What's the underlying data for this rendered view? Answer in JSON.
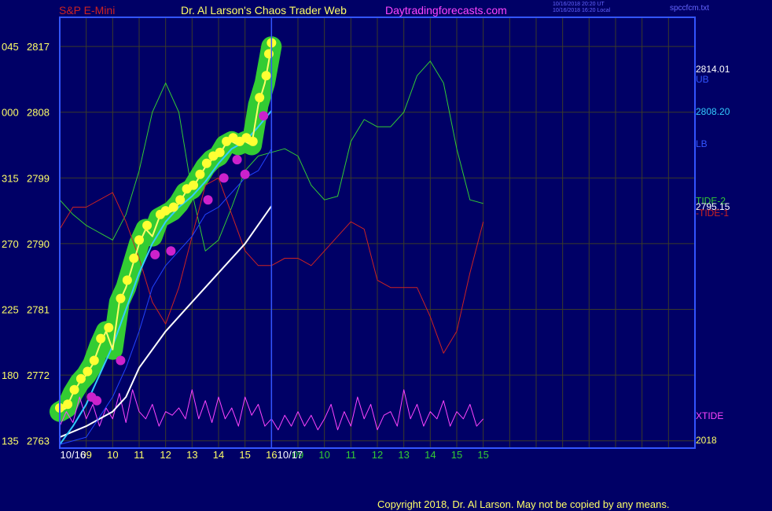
{
  "header": {
    "symbol": "S&P E-Mini",
    "site_title": "Dr. Al Larson's Chaos Trader Web",
    "site_url": "Daytradingforecasts.com",
    "stamp_line1": "10/16/2018 20:20 UT",
    "stamp_line2": "10/16/2018 16:20 Local",
    "file": "spccfcm.txt"
  },
  "footer": {
    "copyright": "Copyright 2018, Dr. Al Larson. May not be copied by any means."
  },
  "colors": {
    "background": "#000066",
    "grid": "#3a3a2a",
    "price": "#ffff66",
    "tide2": "#33cc33",
    "tide1": "#cc2222",
    "xtide": "#ff44ff",
    "cyan_avg": "#33ccff",
    "blue_avg": "#2244ff",
    "white_avg": "#ffffff",
    "highlight": "#33cc33",
    "markers_up": "#ffff33",
    "markers_down": "#cc22cc"
  },
  "chart_data": {
    "type": "line",
    "title": "S&P E-Mini",
    "y_axis": {
      "labels": [
        {
          "left": "045",
          "right": "2817",
          "value": 2817
        },
        {
          "left": "000",
          "right": "2808",
          "value": 2808
        },
        {
          "left": "315",
          "right": "2799",
          "value": 2799
        },
        {
          "left": "270",
          "right": "2790",
          "value": 2790
        },
        {
          "left": "225",
          "right": "2781",
          "value": 2781
        },
        {
          "left": "180",
          "right": "2772",
          "value": 2772
        },
        {
          "left": "135",
          "right": "2763",
          "value": 2763
        }
      ],
      "range": [
        2762,
        2821
      ]
    },
    "x_axis": {
      "range": [
        8.0,
        32.0
      ],
      "hour_labels": [
        {
          "x": 9,
          "label": "09",
          "color": "#ffff66"
        },
        {
          "x": 10,
          "label": "10",
          "color": "#ffff66"
        },
        {
          "x": 11,
          "label": "11",
          "color": "#ffff66"
        },
        {
          "x": 12,
          "label": "12",
          "color": "#ffff66"
        },
        {
          "x": 13,
          "label": "13",
          "color": "#ffff66"
        },
        {
          "x": 14,
          "label": "14",
          "color": "#ffff66"
        },
        {
          "x": 15,
          "label": "15",
          "color": "#ffff66"
        },
        {
          "x": 16,
          "label": "16",
          "color": "#ffff66"
        },
        {
          "x": 17,
          "label": "09",
          "color": "#33cc33"
        },
        {
          "x": 18,
          "label": "10",
          "color": "#33cc33"
        },
        {
          "x": 19,
          "label": "11",
          "color": "#33cc33"
        },
        {
          "x": 20,
          "label": "12",
          "color": "#33cc33"
        },
        {
          "x": 21,
          "label": "13",
          "color": "#33cc33"
        },
        {
          "x": 22,
          "label": "14",
          "color": "#33cc33"
        },
        {
          "x": 23,
          "label": "15",
          "color": "#33cc33"
        },
        {
          "x": 24,
          "label": "15",
          "color": "#33cc33"
        }
      ],
      "date_labels": [
        {
          "x": 8.5,
          "label": "10/16"
        },
        {
          "x": 16.7,
          "label": "10/17"
        }
      ],
      "now_x": 16.0
    },
    "right_labels": [
      {
        "y": 2814.01,
        "text": "2814.01",
        "color": "#ffffff"
      },
      {
        "y": 2812.6,
        "text": "UB",
        "color": "#3355ff"
      },
      {
        "y": 2808.2,
        "text": "2808.20",
        "color": "#33ccff"
      },
      {
        "y": 2803.8,
        "text": "LB",
        "color": "#3355ff"
      },
      {
        "y": 2795.95,
        "text": "TIDE-2",
        "color": "#33cc33"
      },
      {
        "y": 2795.15,
        "text": "2795.15",
        "color": "#ffffff"
      },
      {
        "y": 2794.3,
        "text": "-TIDE-1",
        "color": "#cc2222"
      },
      {
        "y": 2766.5,
        "text": "XTIDE",
        "color": "#ff44ff"
      },
      {
        "y": 2763.2,
        "text": "2018",
        "color": "#ffff66"
      }
    ],
    "series": [
      {
        "name": "TIDE-2",
        "color": "#33cc33",
        "x": [
          8.0,
          8.5,
          9.0,
          9.5,
          10.0,
          10.5,
          11.0,
          11.5,
          12.0,
          12.5,
          13.0,
          13.5,
          14.0,
          14.5,
          15.0,
          15.5,
          16.0,
          16.5,
          17.0,
          17.5,
          18.0,
          18.5,
          19.0,
          19.5,
          20.0,
          20.5,
          21.0,
          21.5,
          22.0,
          22.5,
          23.0,
          23.5,
          24.0
        ],
        "y": [
          2796,
          2794,
          2792.5,
          2791.5,
          2790.5,
          2794,
          2800,
          2808,
          2812,
          2808,
          2797,
          2789,
          2790.5,
          2795,
          2800,
          2802,
          2802.5,
          2803,
          2802,
          2798,
          2796,
          2796.5,
          2804,
          2807,
          2806,
          2806,
          2808,
          2813,
          2815,
          2812,
          2803,
          2796,
          2795.5
        ]
      },
      {
        "name": "-TIDE-1",
        "color": "#cc2222",
        "x": [
          8.0,
          8.5,
          9.0,
          9.5,
          10.0,
          10.5,
          11.0,
          11.5,
          12.0,
          12.5,
          13.0,
          13.5,
          14.0,
          14.5,
          15.0,
          15.5,
          16.0,
          16.5,
          17.0,
          17.5,
          18.0,
          18.5,
          19.0,
          19.5,
          20.0,
          20.5,
          21.0,
          21.5,
          22.0,
          22.5,
          23.0,
          23.5,
          24.0
        ],
        "y": [
          2792,
          2795,
          2795,
          2796,
          2797,
          2793,
          2788,
          2782,
          2779,
          2784,
          2791,
          2798,
          2799,
          2794,
          2789,
          2787,
          2787,
          2788,
          2788,
          2787,
          2789,
          2791,
          2793,
          2792,
          2785,
          2784,
          2784,
          2784,
          2780,
          2775,
          2778,
          2786,
          2793
        ]
      },
      {
        "name": "XTIDE",
        "color": "#ff44ff",
        "x": [
          8.0,
          8.25,
          8.5,
          8.75,
          9.0,
          9.25,
          9.5,
          9.75,
          10.0,
          10.25,
          10.5,
          10.75,
          11.0,
          11.25,
          11.5,
          11.75,
          12.0,
          12.25,
          12.5,
          12.75,
          13.0,
          13.25,
          13.5,
          13.75,
          14.0,
          14.25,
          14.5,
          14.75,
          15.0,
          15.25,
          15.5,
          15.75,
          16.0,
          16.25,
          16.5,
          16.75,
          17.0,
          17.25,
          17.5,
          17.75,
          18.0,
          18.25,
          18.5,
          18.75,
          19.0,
          19.25,
          19.5,
          19.75,
          20.0,
          20.25,
          20.5,
          20.75,
          21.0,
          21.25,
          21.5,
          21.75,
          22.0,
          22.25,
          22.5,
          22.75,
          23.0,
          23.25,
          23.5,
          23.75,
          24.0
        ],
        "y": [
          2765,
          2767,
          2765.5,
          2769,
          2766,
          2768,
          2765,
          2767.5,
          2766,
          2769.5,
          2765.5,
          2770,
          2767,
          2766,
          2768,
          2765,
          2767,
          2766.5,
          2767.5,
          2766,
          2770,
          2766,
          2768.5,
          2765.5,
          2769,
          2766,
          2767.5,
          2765,
          2769,
          2766.5,
          2768,
          2765,
          2766,
          2764.5,
          2766.5,
          2765,
          2767,
          2765,
          2766.5,
          2764.5,
          2766,
          2768,
          2764.5,
          2767,
          2765,
          2769,
          2766,
          2768,
          2764.5,
          2766.5,
          2767,
          2765,
          2770,
          2766,
          2768,
          2765,
          2767,
          2766,
          2768.5,
          2765,
          2767,
          2766,
          2768,
          2765,
          2766
        ]
      },
      {
        "name": "White average",
        "color": "#ffffff",
        "x": [
          8.0,
          9.0,
          10.0,
          10.5,
          11.0,
          12.0,
          13.0,
          14.0,
          15.0,
          16.0
        ],
        "y": [
          2763.5,
          2765,
          2767,
          2769,
          2773,
          2778,
          2782,
          2786,
          2790,
          2795.15
        ]
      },
      {
        "name": "Blue average",
        "color": "#2244ff",
        "x": [
          8.0,
          9.0,
          10.0,
          10.5,
          11.0,
          11.5,
          12.0,
          12.5,
          13.0,
          13.5,
          14.0,
          14.5,
          15.0,
          15.5,
          16.0
        ],
        "y": [
          2762.5,
          2763.5,
          2769,
          2773,
          2778,
          2784,
          2787,
          2789,
          2791,
          2794,
          2795,
          2797,
          2799,
          2800,
          2803
        ]
      },
      {
        "name": "Cyan average",
        "color": "#33ccff",
        "x": [
          8.0,
          8.5,
          9.0,
          9.5,
          10.0,
          10.5,
          11.0,
          11.5,
          12.0,
          12.5,
          13.0,
          13.5,
          14.0,
          14.5,
          15.0,
          15.5,
          16.0
        ],
        "y": [
          2762.5,
          2765,
          2768,
          2772,
          2776,
          2781,
          2786,
          2790,
          2793,
          2795,
          2796.5,
          2798.5,
          2801,
          2803,
          2804,
          2806,
          2808.2
        ]
      },
      {
        "name": "Price",
        "color": "#ffff66",
        "x": [
          8.0,
          8.25,
          8.5,
          8.75,
          9.0,
          9.25,
          9.5,
          9.75,
          10.0,
          10.25,
          10.5,
          10.75,
          11.0,
          11.25,
          11.5,
          11.75,
          12.0,
          12.25,
          12.5,
          12.75,
          13.0,
          13.25,
          13.5,
          13.75,
          14.0,
          14.25,
          14.5,
          14.75,
          15.0,
          15.25,
          15.5,
          15.75,
          16.0
        ],
        "y": [
          2767,
          2767.5,
          2769.5,
          2771,
          2772,
          2773.5,
          2776,
          2778,
          2775.5,
          2782,
          2784,
          2787,
          2790,
          2792,
          2791,
          2793.5,
          2794,
          2794.5,
          2795.5,
          2797,
          2797.5,
          2799,
          2800.5,
          2801.5,
          2802,
          2803.5,
          2804,
          2803.5,
          2804,
          2803.5,
          2809,
          2812,
          2817
        ]
      }
    ],
    "highlight_band": {
      "color": "#33cc33",
      "along": "Price"
    },
    "markers": {
      "up": [
        {
          "x": 8.0,
          "y": 2767.5
        },
        {
          "x": 8.3,
          "y": 2768
        },
        {
          "x": 8.55,
          "y": 2770
        },
        {
          "x": 8.8,
          "y": 2771.5
        },
        {
          "x": 9.05,
          "y": 2772.5
        },
        {
          "x": 9.3,
          "y": 2774
        },
        {
          "x": 9.55,
          "y": 2777
        },
        {
          "x": 9.85,
          "y": 2778.5
        },
        {
          "x": 10.3,
          "y": 2782.5
        },
        {
          "x": 10.55,
          "y": 2785
        },
        {
          "x": 10.8,
          "y": 2788
        },
        {
          "x": 11.0,
          "y": 2790.5
        },
        {
          "x": 11.3,
          "y": 2792.5
        },
        {
          "x": 11.8,
          "y": 2794
        },
        {
          "x": 12.0,
          "y": 2794.5
        },
        {
          "x": 12.3,
          "y": 2795
        },
        {
          "x": 12.55,
          "y": 2796
        },
        {
          "x": 12.8,
          "y": 2797.5
        },
        {
          "x": 13.05,
          "y": 2798
        },
        {
          "x": 13.3,
          "y": 2799.5
        },
        {
          "x": 13.55,
          "y": 2801
        },
        {
          "x": 13.8,
          "y": 2802
        },
        {
          "x": 14.05,
          "y": 2802.5
        },
        {
          "x": 14.3,
          "y": 2804
        },
        {
          "x": 14.55,
          "y": 2804.5
        },
        {
          "x": 14.8,
          "y": 2804
        },
        {
          "x": 15.05,
          "y": 2804.5
        },
        {
          "x": 15.3,
          "y": 2804
        },
        {
          "x": 15.55,
          "y": 2810
        },
        {
          "x": 15.8,
          "y": 2813
        },
        {
          "x": 16.0,
          "y": 2817.5
        },
        {
          "x": 15.9,
          "y": 2816
        }
      ],
      "down": [
        {
          "x": 9.2,
          "y": 2769
        },
        {
          "x": 9.4,
          "y": 2768.5
        },
        {
          "x": 10.3,
          "y": 2774
        },
        {
          "x": 11.6,
          "y": 2788.5
        },
        {
          "x": 12.2,
          "y": 2789
        },
        {
          "x": 13.6,
          "y": 2796
        },
        {
          "x": 14.2,
          "y": 2799
        },
        {
          "x": 14.7,
          "y": 2801.5
        },
        {
          "x": 15.0,
          "y": 2799.5
        },
        {
          "x": 15.7,
          "y": 2807.5
        }
      ]
    }
  }
}
